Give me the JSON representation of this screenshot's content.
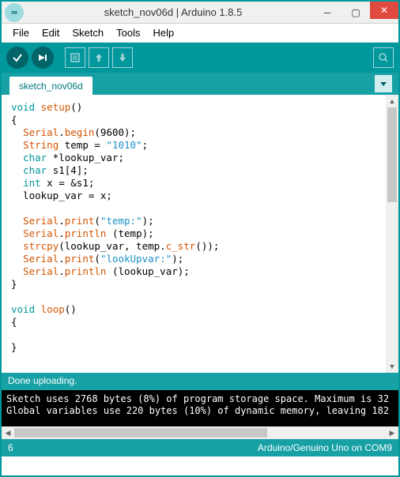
{
  "window": {
    "title": "sketch_nov06d | Arduino 1.8.5"
  },
  "menubar": {
    "items": [
      "File",
      "Edit",
      "Sketch",
      "Tools",
      "Help"
    ]
  },
  "tabbar": {
    "tab_name": "sketch_nov06d"
  },
  "code": {
    "lines": [
      {
        "t": "kw-type",
        "v": "void"
      },
      {
        "t": "plain",
        "v": " "
      },
      {
        "t": "kw-func",
        "v": "setup"
      },
      {
        "t": "plain",
        "v": "()"
      },
      {
        "nl": 1
      },
      {
        "t": "plain",
        "v": "{"
      },
      {
        "nl": 1
      },
      {
        "t": "plain",
        "v": "  "
      },
      {
        "t": "kw-func",
        "v": "Serial"
      },
      {
        "t": "plain",
        "v": "."
      },
      {
        "t": "kw-func",
        "v": "begin"
      },
      {
        "t": "plain",
        "v": "(9600);"
      },
      {
        "nl": 1
      },
      {
        "t": "plain",
        "v": "  "
      },
      {
        "t": "kw-func",
        "v": "String"
      },
      {
        "t": "plain",
        "v": " temp = "
      },
      {
        "t": "kw-str",
        "v": "\"1010\""
      },
      {
        "t": "plain",
        "v": ";"
      },
      {
        "nl": 1
      },
      {
        "t": "plain",
        "v": "  "
      },
      {
        "t": "kw-type",
        "v": "char"
      },
      {
        "t": "plain",
        "v": " *lookup_var;"
      },
      {
        "nl": 1
      },
      {
        "t": "plain",
        "v": "  "
      },
      {
        "t": "kw-type",
        "v": "char"
      },
      {
        "t": "plain",
        "v": " s1[4];"
      },
      {
        "nl": 1
      },
      {
        "t": "plain",
        "v": "  "
      },
      {
        "t": "kw-type",
        "v": "int"
      },
      {
        "t": "plain",
        "v": " x = &s1;"
      },
      {
        "nl": 1
      },
      {
        "t": "plain",
        "v": "  lookup_var = x;"
      },
      {
        "nl": 1
      },
      {
        "nl": 1
      },
      {
        "t": "plain",
        "v": "  "
      },
      {
        "t": "kw-func",
        "v": "Serial"
      },
      {
        "t": "plain",
        "v": "."
      },
      {
        "t": "kw-func",
        "v": "print"
      },
      {
        "t": "plain",
        "v": "("
      },
      {
        "t": "kw-str",
        "v": "\"temp:\""
      },
      {
        "t": "plain",
        "v": ");"
      },
      {
        "nl": 1
      },
      {
        "t": "plain",
        "v": "  "
      },
      {
        "t": "kw-func",
        "v": "Serial"
      },
      {
        "t": "plain",
        "v": "."
      },
      {
        "t": "kw-func",
        "v": "println"
      },
      {
        "t": "plain",
        "v": " (temp);"
      },
      {
        "nl": 1
      },
      {
        "t": "plain",
        "v": "  "
      },
      {
        "t": "kw-func",
        "v": "strcpy"
      },
      {
        "t": "plain",
        "v": "(lookup_var, temp."
      },
      {
        "t": "kw-func",
        "v": "c_str"
      },
      {
        "t": "plain",
        "v": "());"
      },
      {
        "nl": 1
      },
      {
        "t": "plain",
        "v": "  "
      },
      {
        "t": "kw-func",
        "v": "Serial"
      },
      {
        "t": "plain",
        "v": "."
      },
      {
        "t": "kw-func",
        "v": "print"
      },
      {
        "t": "plain",
        "v": "("
      },
      {
        "t": "kw-str",
        "v": "\"lookUpvar:\""
      },
      {
        "t": "plain",
        "v": ");"
      },
      {
        "nl": 1
      },
      {
        "t": "plain",
        "v": "  "
      },
      {
        "t": "kw-func",
        "v": "Serial"
      },
      {
        "t": "plain",
        "v": "."
      },
      {
        "t": "kw-func",
        "v": "println"
      },
      {
        "t": "plain",
        "v": " (lookup_var);"
      },
      {
        "nl": 1
      },
      {
        "t": "plain",
        "v": "}"
      },
      {
        "nl": 1
      },
      {
        "nl": 1
      },
      {
        "t": "kw-type",
        "v": "void"
      },
      {
        "t": "plain",
        "v": " "
      },
      {
        "t": "kw-func",
        "v": "loop"
      },
      {
        "t": "plain",
        "v": "()"
      },
      {
        "nl": 1
      },
      {
        "t": "plain",
        "v": "{"
      },
      {
        "nl": 1
      },
      {
        "nl": 1
      },
      {
        "t": "plain",
        "v": "}"
      }
    ]
  },
  "status": {
    "message": "Done uploading."
  },
  "console": {
    "line1": "Sketch uses 2768 bytes (8%) of program storage space. Maximum is 32",
    "line2": "Global variables use 220 bytes (10%) of dynamic memory, leaving 182"
  },
  "footer": {
    "line_number": "6",
    "board_port": "Arduino/Genuino Uno on COM9"
  }
}
